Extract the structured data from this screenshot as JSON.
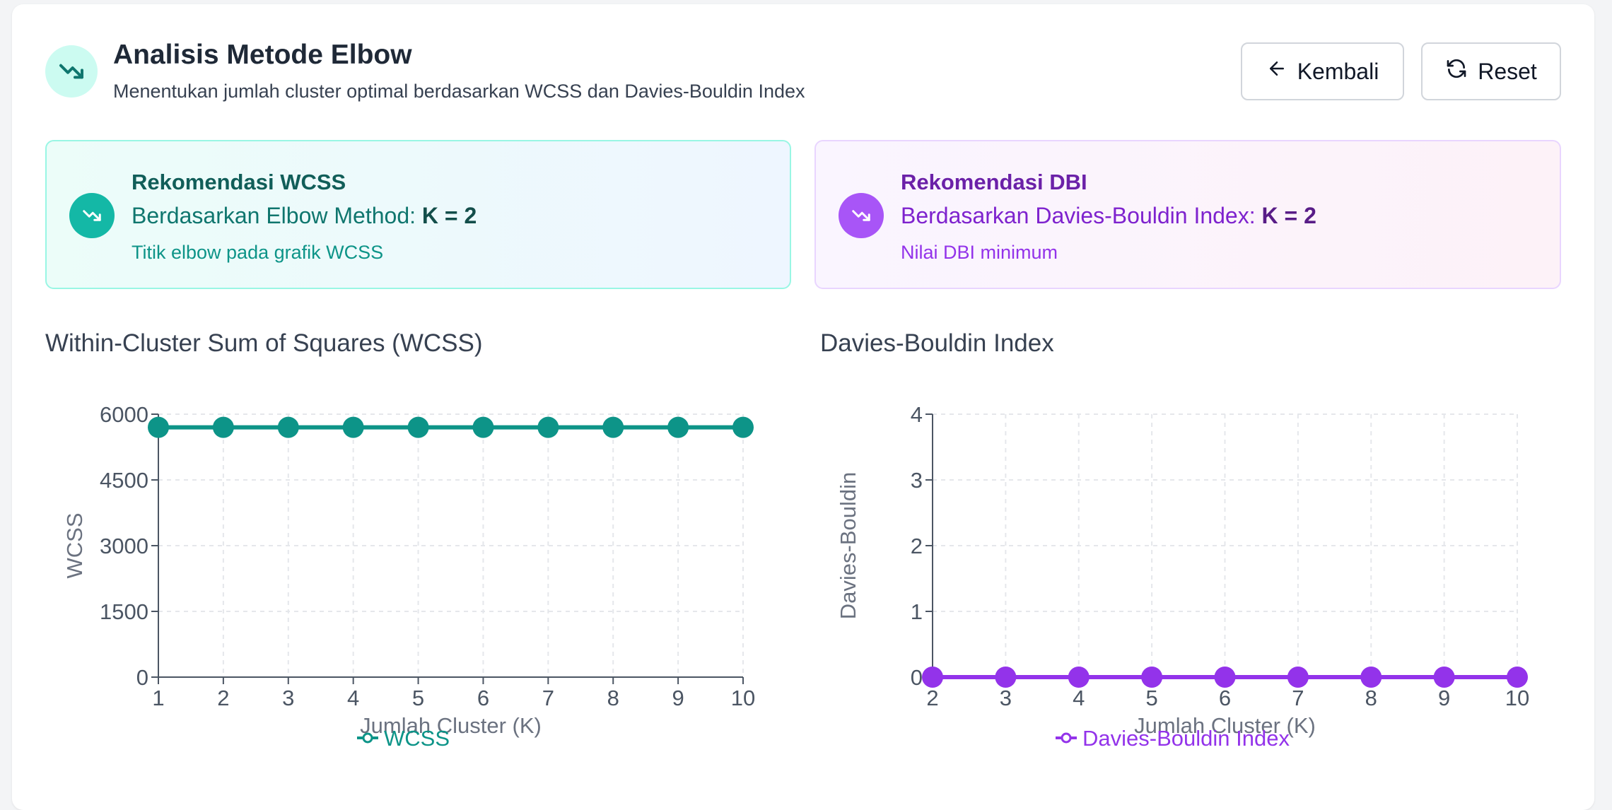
{
  "header": {
    "title": "Analisis Metode Elbow",
    "subtitle": "Menentukan jumlah cluster optimal berdasarkan WCSS dan Davies-Bouldin Index",
    "icon": "trending-down-icon",
    "back_label": "Kembali",
    "reset_label": "Reset"
  },
  "rec_wcss": {
    "title": "Rekomendasi WCSS",
    "prefix": "Berdasarkan Elbow Method:",
    "value": "K = 2",
    "note": "Titik elbow pada grafik WCSS",
    "icon": "trending-down-icon"
  },
  "rec_dbi": {
    "title": "Rekomendasi DBI",
    "prefix": "Berdasarkan Davies-Bouldin Index:",
    "value": "K = 2",
    "note": "Nilai DBI minimum",
    "icon": "trending-down-icon"
  },
  "colors": {
    "teal": "#0d9488",
    "purple": "#9333ea"
  },
  "chart_data": [
    {
      "type": "line",
      "title": "Within-Cluster Sum of Squares (WCSS)",
      "xlabel": "Jumlah Cluster (K)",
      "ylabel": "WCSS",
      "x": [
        1,
        2,
        3,
        4,
        5,
        6,
        7,
        8,
        9,
        10
      ],
      "series": [
        {
          "name": "WCSS",
          "values": [
            5700,
            5700,
            5700,
            5700,
            5700,
            5700,
            5700,
            5700,
            5700,
            5700
          ],
          "color": "#0d9488"
        }
      ],
      "yticks": [
        "0",
        "1500",
        "3000",
        "4500",
        "6000"
      ],
      "ylim": [
        0,
        6000
      ],
      "grid": true,
      "legend": "bottom"
    },
    {
      "type": "line",
      "title": "Davies-Bouldin Index",
      "xlabel": "Jumlah Cluster (K)",
      "ylabel": "Davies-Bouldin",
      "x": [
        2,
        3,
        4,
        5,
        6,
        7,
        8,
        9,
        10
      ],
      "series": [
        {
          "name": "Davies-Bouldin Index",
          "values": [
            0,
            0,
            0,
            0,
            0,
            0,
            0,
            0,
            0
          ],
          "color": "#9333ea"
        }
      ],
      "yticks": [
        "0",
        "1",
        "2",
        "3",
        "4"
      ],
      "ylim": [
        0,
        4
      ],
      "grid": true,
      "legend": "bottom"
    }
  ]
}
